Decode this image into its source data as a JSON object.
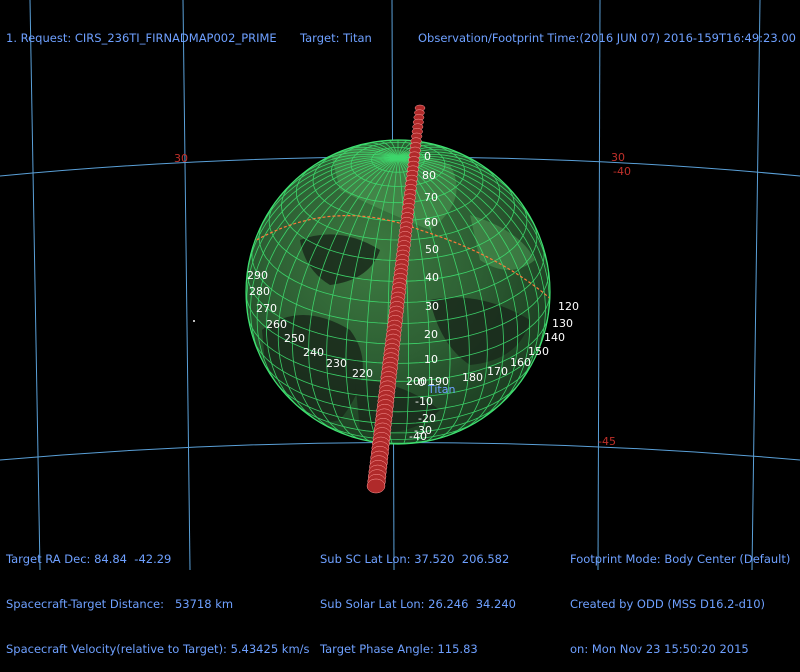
{
  "header": {
    "request": "1. Request: CIRS_236TI_FIRNADMAP002_PRIME",
    "target": "Target: Titan",
    "observation_time": "Observation/Footprint Time:(2016 JUN 07) 2016-159T16:49:23.00"
  },
  "footer": {
    "left": {
      "ra_dec": "Target RA Dec: 84.84  -42.29",
      "distance": "Spacecraft-Target Distance:   53718 km",
      "velocity": "Spacecraft Velocity(relative to Target): 5.43425 km/s"
    },
    "middle": {
      "sub_sc": "Sub SC Lat Lon: 37.520  206.582",
      "sub_solar": "Sub Solar Lat Lon: 26.246  34.240",
      "phase": "Target Phase Angle: 115.83"
    },
    "right": {
      "mode": "Footprint Mode: Body Center (Default)",
      "created_by": "Created by ODD (MSS D16.2-d10)",
      "created_on": "on: Mon Nov 23 15:50:20 2015"
    }
  },
  "sky_grid_labels": [
    "30",
    "30",
    "-40",
    "-45"
  ],
  "body_label": "Titan",
  "lat_labels": [
    "0",
    "80",
    "70",
    "60",
    "50",
    "40",
    "30",
    "20",
    "10",
    "0",
    "-10",
    "-20",
    "-30",
    "-40"
  ],
  "lon_labels": [
    "290",
    "280",
    "270",
    "260",
    "250",
    "240",
    "230",
    "220",
    "200",
    "190",
    "180",
    "170",
    "160",
    "150",
    "140",
    "130",
    "120"
  ],
  "colors": {
    "hud_text": "#6ea0ff",
    "sky_grid": "#5aa0d8",
    "sky_grid_label": "#c0302a",
    "globe_grid": "#3fe070",
    "globe_fill": "#2f6a35",
    "footprint": "#b02a2a",
    "footprint_outline": "#ff9a9a",
    "graticule_label": "#ffffff"
  }
}
